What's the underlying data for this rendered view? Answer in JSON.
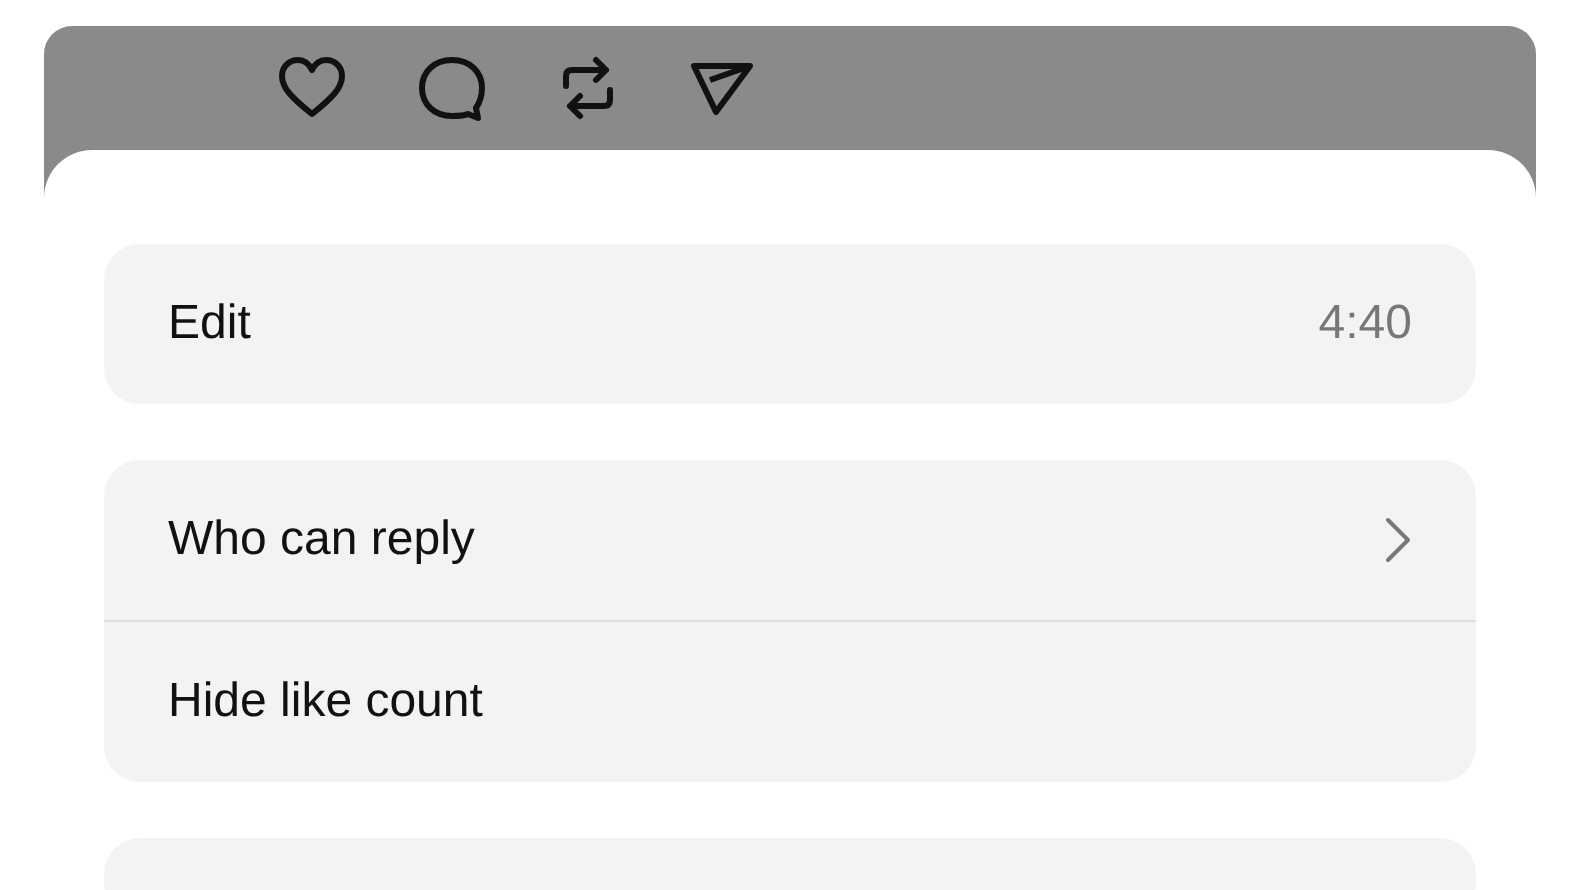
{
  "sheet": {
    "first_group": [
      {
        "kind": "value",
        "label": "Edit",
        "value": "4:40"
      }
    ],
    "second_group": [
      {
        "kind": "chevron",
        "label": "Who can reply"
      },
      {
        "kind": "plain",
        "label": "Hide like count"
      }
    ]
  }
}
